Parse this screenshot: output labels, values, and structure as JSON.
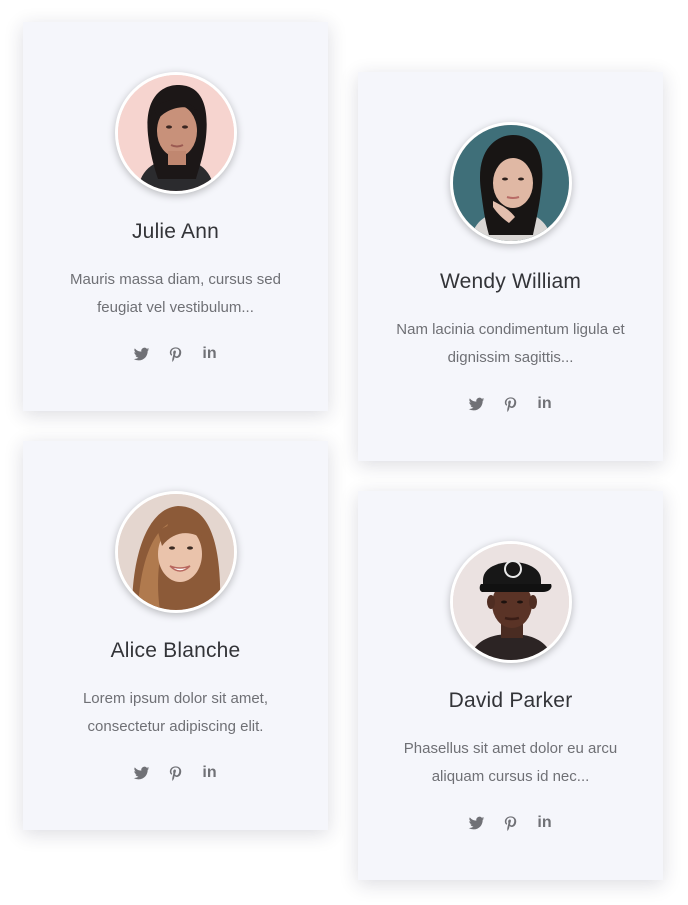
{
  "team": [
    {
      "name": "Julie Ann",
      "description": "Mauris massa diam, cursus sed feugiat vel vestibulum...",
      "avatar_bg": "#f6d4cf"
    },
    {
      "name": "Wendy William",
      "description": "Nam lacinia condimentum ligula et dignissim sagittis...",
      "avatar_bg": "#3f6f79"
    },
    {
      "name": "Alice Blanche",
      "description": "Lorem ipsum dolor sit amet, consectetur adipiscing elit.",
      "avatar_bg": "#e4d6cf"
    },
    {
      "name": "David Parker",
      "description": "Phasellus sit amet dolor eu arcu aliquam cursus id nec...",
      "avatar_bg": "#ebe2e1"
    }
  ],
  "social_icons": [
    "twitter-icon",
    "pinterest-icon",
    "linkedin-icon"
  ],
  "linkedin_glyph": "in",
  "colors": {
    "card_bg": "#f5f6fb",
    "name_text": "#333438",
    "body_text": "#6f7075",
    "icon": "#707176"
  }
}
